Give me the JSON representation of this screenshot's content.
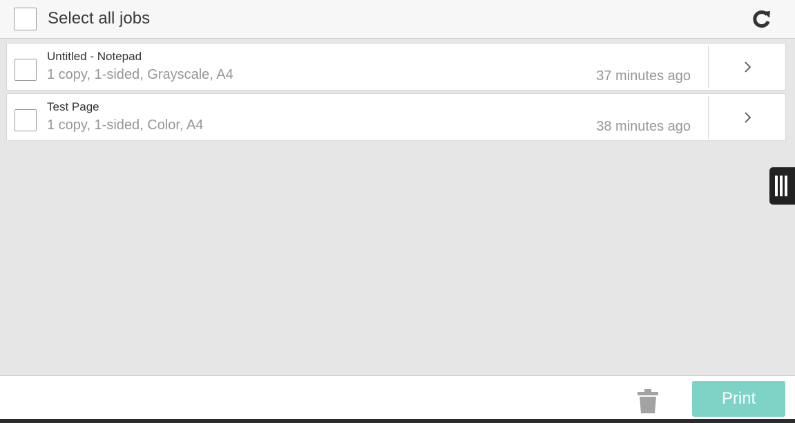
{
  "header": {
    "select_all_label": "Select all jobs",
    "refresh_icon": "refresh-icon"
  },
  "jobs": [
    {
      "title": "Untitled - Notepad",
      "details": "1 copy, 1-sided, Grayscale, A4",
      "time": "37 minutes ago",
      "selected": false
    },
    {
      "title": "Test Page",
      "details": "1 copy, 1-sided, Color, A4",
      "time": "38 minutes ago",
      "selected": false
    }
  ],
  "side_panel": {
    "icon": "panel-handle-icon"
  },
  "footer": {
    "delete_icon": "trash-icon",
    "print_label": "Print",
    "print_color": "#7fd3c6"
  }
}
